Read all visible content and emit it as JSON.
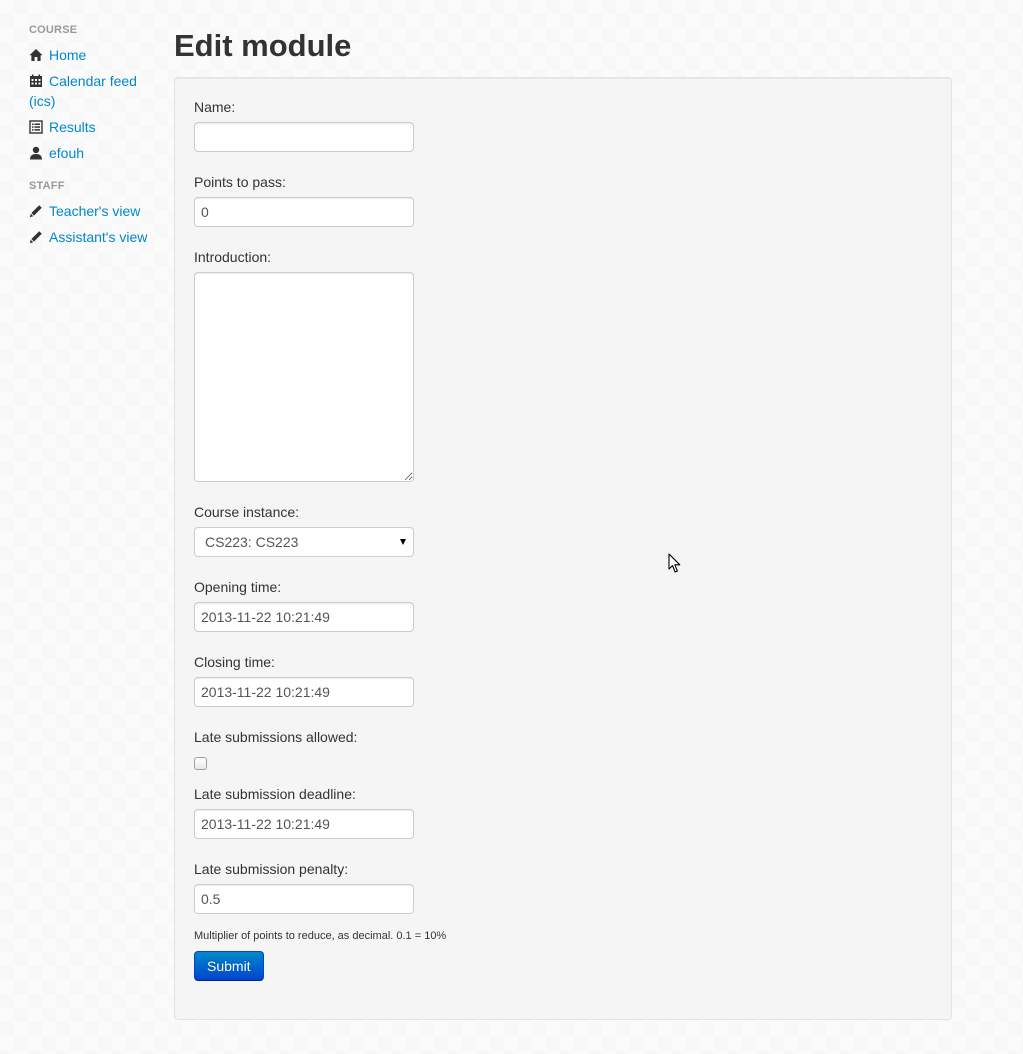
{
  "sidebar": {
    "course_header": "COURSE",
    "course_items": [
      {
        "label": "Home",
        "icon": "home-icon"
      },
      {
        "label": "Calendar feed (ics)",
        "icon": "calendar-icon"
      },
      {
        "label": "Results",
        "icon": "list-icon"
      },
      {
        "label": "efouh",
        "icon": "user-icon"
      }
    ],
    "staff_header": "STAFF",
    "staff_items": [
      {
        "label": "Teacher's view",
        "icon": "pencil-icon"
      },
      {
        "label": "Assistant's view",
        "icon": "pencil-icon"
      }
    ]
  },
  "page": {
    "title": "Edit module"
  },
  "form": {
    "name": {
      "label": "Name:",
      "value": ""
    },
    "points_to_pass": {
      "label": "Points to pass:",
      "value": "0"
    },
    "introduction": {
      "label": "Introduction:",
      "value": ""
    },
    "course_instance": {
      "label": "Course instance:",
      "value": "CS223: CS223"
    },
    "opening_time": {
      "label": "Opening time:",
      "value": "2013-11-22 10:21:49"
    },
    "closing_time": {
      "label": "Closing time:",
      "value": "2013-11-22 10:21:49"
    },
    "late_submissions_allowed": {
      "label": "Late submissions allowed:",
      "checked": false
    },
    "late_submission_deadline": {
      "label": "Late submission deadline:",
      "value": "2013-11-22 10:21:49"
    },
    "late_submission_penalty": {
      "label": "Late submission penalty:",
      "value": "0.5",
      "help": "Multiplier of points to reduce, as decimal. 0.1 = 10%"
    },
    "submit_label": "Submit"
  },
  "colors": {
    "link": "#0088cc",
    "primary_button": "#0044cc",
    "well_background": "#f5f5f5"
  }
}
